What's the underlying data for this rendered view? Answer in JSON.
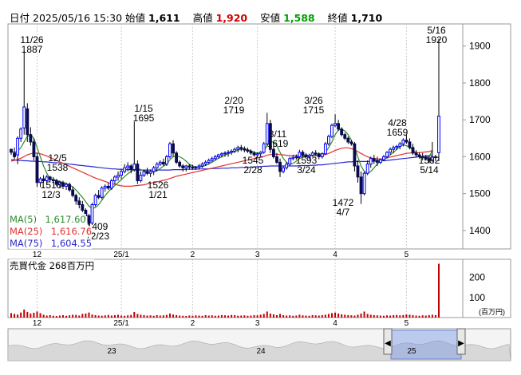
{
  "header": {
    "date_label": "日付",
    "datetime": "2025/05/16 15:30",
    "open_label": "始値",
    "open": "1,611",
    "high_label": "高値",
    "high": "1,920",
    "low_label": "安値",
    "low": "1,588",
    "close_label": "終値",
    "close": "1,710"
  },
  "moving_averages": [
    {
      "label": "MA(5)",
      "value": "1,617.60",
      "color": "#2e8b2e"
    },
    {
      "label": "MA(25)",
      "value": "1,616.76",
      "color": "#e03030"
    },
    {
      "label": "MA(75)",
      "value": "1,604.55",
      "color": "#2828d0"
    }
  ],
  "volume_panel": {
    "label": "売買代金",
    "value": "268百万円",
    "unit": "(百万円)"
  },
  "colors": {
    "up": "#0000ff",
    "down": "#0a0a50",
    "high_value": "#d00000",
    "low_value": "#00a000",
    "volume": "#c00000"
  },
  "chart_data": {
    "type": "candlestick",
    "ylim": [
      1350,
      1960
    ],
    "yticks": [
      1400,
      1500,
      1600,
      1700,
      1800,
      1900
    ],
    "volume_ticks": [
      100,
      200
    ],
    "x_labels": [
      "12",
      "25/1",
      "2",
      "3",
      "4",
      "5"
    ],
    "scroller_labels": [
      "23",
      "24",
      "25"
    ],
    "annotations": [
      {
        "date": "11/26",
        "value": "1887"
      },
      {
        "date": "12/3",
        "value": "1518"
      },
      {
        "date": "12/5",
        "value": "1538"
      },
      {
        "date": "12/23",
        "value": "1409"
      },
      {
        "date": "1/15",
        "value": "1695"
      },
      {
        "date": "1/21",
        "value": "1526"
      },
      {
        "date": "2/20",
        "value": "1719"
      },
      {
        "date": "2/28",
        "value": "1545"
      },
      {
        "date": "3/11",
        "value": "1619"
      },
      {
        "date": "3/24",
        "value": "1593"
      },
      {
        "date": "3/26",
        "value": "1715"
      },
      {
        "date": "4/7",
        "value": "1472"
      },
      {
        "date": "4/28",
        "value": "1659"
      },
      {
        "date": "5/14",
        "value": "1582"
      },
      {
        "date": "5/16",
        "value": "1920"
      }
    ],
    "candles": [
      [
        1620,
        1622,
        1605,
        1612
      ],
      [
        1610,
        1625,
        1592,
        1600
      ],
      [
        1605,
        1655,
        1580,
        1650
      ],
      [
        1650,
        1680,
        1640,
        1675
      ],
      [
        1678,
        1887,
        1660,
        1735
      ],
      [
        1730,
        1745,
        1640,
        1660
      ],
      [
        1660,
        1680,
        1630,
        1640
      ],
      [
        1640,
        1650,
        1590,
        1600
      ],
      [
        1600,
        1610,
        1518,
        1530
      ],
      [
        1530,
        1545,
        1518,
        1540
      ],
      [
        1540,
        1550,
        1530,
        1535
      ],
      [
        1535,
        1550,
        1525,
        1545
      ],
      [
        1545,
        1548,
        1530,
        1538
      ],
      [
        1538,
        1545,
        1530,
        1535
      ],
      [
        1535,
        1540,
        1520,
        1525
      ],
      [
        1525,
        1535,
        1515,
        1530
      ],
      [
        1530,
        1535,
        1512,
        1520
      ],
      [
        1520,
        1530,
        1510,
        1525
      ],
      [
        1525,
        1530,
        1505,
        1510
      ],
      [
        1510,
        1520,
        1490,
        1495
      ],
      [
        1495,
        1500,
        1470,
        1480
      ],
      [
        1480,
        1490,
        1460,
        1470
      ],
      [
        1470,
        1480,
        1450,
        1455
      ],
      [
        1455,
        1460,
        1430,
        1440
      ],
      [
        1440,
        1445,
        1409,
        1420
      ],
      [
        1420,
        1475,
        1415,
        1470
      ],
      [
        1470,
        1500,
        1465,
        1495
      ],
      [
        1495,
        1510,
        1485,
        1490
      ],
      [
        1490,
        1520,
        1485,
        1515
      ],
      [
        1515,
        1525,
        1505,
        1520
      ],
      [
        1520,
        1530,
        1510,
        1515
      ],
      [
        1515,
        1540,
        1510,
        1535
      ],
      [
        1535,
        1550,
        1525,
        1545
      ],
      [
        1545,
        1560,
        1535,
        1550
      ],
      [
        1550,
        1565,
        1540,
        1560
      ],
      [
        1560,
        1580,
        1555,
        1570
      ],
      [
        1570,
        1585,
        1560,
        1575
      ],
      [
        1575,
        1580,
        1555,
        1565
      ],
      [
        1565,
        1695,
        1560,
        1580
      ],
      [
        1580,
        1590,
        1526,
        1535
      ],
      [
        1535,
        1560,
        1530,
        1550
      ],
      [
        1550,
        1565,
        1545,
        1560
      ],
      [
        1560,
        1570,
        1550,
        1555
      ],
      [
        1555,
        1565,
        1545,
        1560
      ],
      [
        1560,
        1575,
        1550,
        1570
      ],
      [
        1570,
        1585,
        1560,
        1580
      ],
      [
        1580,
        1590,
        1575,
        1585
      ],
      [
        1585,
        1595,
        1575,
        1580
      ],
      [
        1580,
        1605,
        1575,
        1600
      ],
      [
        1600,
        1640,
        1595,
        1635
      ],
      [
        1635,
        1645,
        1600,
        1610
      ],
      [
        1610,
        1615,
        1580,
        1585
      ],
      [
        1585,
        1590,
        1570,
        1575
      ],
      [
        1575,
        1580,
        1560,
        1570
      ],
      [
        1570,
        1578,
        1560,
        1575
      ],
      [
        1575,
        1580,
        1565,
        1572
      ],
      [
        1572,
        1578,
        1565,
        1570
      ],
      [
        1570,
        1575,
        1565,
        1572
      ],
      [
        1572,
        1580,
        1565,
        1575
      ],
      [
        1575,
        1585,
        1570,
        1580
      ],
      [
        1580,
        1590,
        1575,
        1585
      ],
      [
        1585,
        1595,
        1580,
        1590
      ],
      [
        1590,
        1600,
        1585,
        1595
      ],
      [
        1595,
        1605,
        1590,
        1600
      ],
      [
        1600,
        1608,
        1595,
        1605
      ],
      [
        1605,
        1612,
        1598,
        1608
      ],
      [
        1608,
        1615,
        1600,
        1610
      ],
      [
        1610,
        1618,
        1600,
        1612
      ],
      [
        1612,
        1620,
        1605,
        1615
      ],
      [
        1615,
        1625,
        1610,
        1620
      ],
      [
        1620,
        1630,
        1612,
        1625
      ],
      [
        1625,
        1632,
        1615,
        1622
      ],
      [
        1622,
        1628,
        1612,
        1618
      ],
      [
        1618,
        1625,
        1610,
        1615
      ],
      [
        1615,
        1620,
        1605,
        1610
      ],
      [
        1610,
        1615,
        1600,
        1605
      ],
      [
        1605,
        1612,
        1598,
        1608
      ],
      [
        1608,
        1615,
        1600,
        1612
      ],
      [
        1612,
        1640,
        1608,
        1635
      ],
      [
        1635,
        1719,
        1630,
        1690
      ],
      [
        1690,
        1700,
        1610,
        1620
      ],
      [
        1620,
        1630,
        1595,
        1600
      ],
      [
        1600,
        1610,
        1580,
        1585
      ],
      [
        1585,
        1595,
        1545,
        1560
      ],
      [
        1560,
        1575,
        1555,
        1570
      ],
      [
        1570,
        1585,
        1565,
        1580
      ],
      [
        1580,
        1600,
        1575,
        1595
      ],
      [
        1595,
        1605,
        1590,
        1598
      ],
      [
        1598,
        1606,
        1592,
        1600
      ],
      [
        1600,
        1619,
        1595,
        1612
      ],
      [
        1612,
        1618,
        1600,
        1605
      ],
      [
        1605,
        1610,
        1595,
        1600
      ],
      [
        1600,
        1608,
        1592,
        1604
      ],
      [
        1604,
        1615,
        1600,
        1610
      ],
      [
        1610,
        1618,
        1602,
        1608
      ],
      [
        1608,
        1612,
        1593,
        1600
      ],
      [
        1600,
        1612,
        1595,
        1608
      ],
      [
        1608,
        1640,
        1605,
        1635
      ],
      [
        1635,
        1660,
        1630,
        1655
      ],
      [
        1655,
        1690,
        1650,
        1685
      ],
      [
        1685,
        1715,
        1680,
        1690
      ],
      [
        1690,
        1700,
        1670,
        1675
      ],
      [
        1675,
        1680,
        1655,
        1660
      ],
      [
        1660,
        1665,
        1645,
        1650
      ],
      [
        1650,
        1655,
        1635,
        1640
      ],
      [
        1640,
        1645,
        1630,
        1635
      ],
      [
        1635,
        1640,
        1560,
        1575
      ],
      [
        1575,
        1590,
        1530,
        1545
      ],
      [
        1545,
        1560,
        1472,
        1500
      ],
      [
        1500,
        1560,
        1495,
        1555
      ],
      [
        1555,
        1590,
        1550,
        1580
      ],
      [
        1580,
        1600,
        1570,
        1595
      ],
      [
        1595,
        1605,
        1580,
        1590
      ],
      [
        1590,
        1600,
        1575,
        1585
      ],
      [
        1585,
        1595,
        1580,
        1592
      ],
      [
        1592,
        1605,
        1588,
        1600
      ],
      [
        1600,
        1615,
        1595,
        1612
      ],
      [
        1612,
        1625,
        1605,
        1620
      ],
      [
        1620,
        1630,
        1610,
        1625
      ],
      [
        1625,
        1632,
        1618,
        1628
      ],
      [
        1628,
        1640,
        1620,
        1635
      ],
      [
        1635,
        1650,
        1628,
        1645
      ],
      [
        1645,
        1659,
        1635,
        1640
      ],
      [
        1640,
        1650,
        1620,
        1625
      ],
      [
        1625,
        1635,
        1605,
        1610
      ],
      [
        1610,
        1618,
        1598,
        1605
      ],
      [
        1605,
        1612,
        1595,
        1600
      ],
      [
        1600,
        1610,
        1590,
        1598
      ],
      [
        1598,
        1605,
        1590,
        1595
      ],
      [
        1595,
        1602,
        1582,
        1590
      ],
      [
        1590,
        1640,
        1585,
        1600
      ],
      [
        1600,
        1605,
        1588,
        1598
      ],
      [
        1611,
        1920,
        1588,
        1710
      ]
    ],
    "ma5": [
      1615,
      1612,
      1615,
      1625,
      1640,
      1655,
      1660,
      1650,
      1625,
      1600,
      1575,
      1555,
      1540,
      1538,
      1536,
      1533,
      1530,
      1527,
      1524,
      1518,
      1510,
      1500,
      1490,
      1478,
      1466,
      1460,
      1462,
      1470,
      1482,
      1495,
      1505,
      1514,
      1522,
      1530,
      1538,
      1546,
      1554,
      1560,
      1565,
      1568,
      1565,
      1562,
      1560,
      1558,
      1559,
      1562,
      1568,
      1574,
      1580,
      1592,
      1600,
      1602,
      1600,
      1595,
      1588,
      1580,
      1575,
      1572,
      1572,
      1573,
      1576,
      1580,
      1585,
      1590,
      1596,
      1600,
      1604,
      1608,
      1611,
      1614,
      1618,
      1620,
      1620,
      1619,
      1616,
      1612,
      1610,
      1610,
      1617,
      1630,
      1640,
      1640,
      1630,
      1612,
      1595,
      1585,
      1580,
      1582,
      1588,
      1595,
      1600,
      1602,
      1604,
      1605,
      1606,
      1604,
      1605,
      1612,
      1625,
      1640,
      1660,
      1672,
      1675,
      1670,
      1660,
      1645,
      1625,
      1600,
      1575,
      1560,
      1555,
      1560,
      1570,
      1580,
      1588,
      1592,
      1598,
      1605,
      1612,
      1620,
      1628,
      1632,
      1630,
      1625,
      1618,
      1610,
      1602,
      1598,
      1596,
      1598,
      1618
    ],
    "ma25": [
      1588,
      1590,
      1593,
      1596,
      1600,
      1605,
      1608,
      1610,
      1610,
      1608,
      1605,
      1602,
      1598,
      1594,
      1590,
      1586,
      1582,
      1578,
      1574,
      1570,
      1566,
      1562,
      1558,
      1554,
      1550,
      1546,
      1542,
      1539,
      1536,
      1533,
      1530,
      1527,
      1525,
      1523,
      1521,
      1520,
      1520,
      1520,
      1521,
      1522,
      1523,
      1524,
      1526,
      1528,
      1530,
      1532,
      1534,
      1536,
      1538,
      1541,
      1544,
      1547,
      1549,
      1551,
      1553,
      1555,
      1557,
      1559,
      1561,
      1563,
      1565,
      1567,
      1569,
      1571,
      1573,
      1575,
      1577,
      1579,
      1581,
      1583,
      1585,
      1587,
      1589,
      1591,
      1593,
      1595,
      1597,
      1599,
      1601,
      1604,
      1606,
      1607,
      1607,
      1606,
      1605,
      1604,
      1603,
      1603,
      1603,
      1603,
      1603,
      1603,
      1603,
      1603,
      1603,
      1603,
      1604,
      1606,
      1609,
      1613,
      1617,
      1620,
      1623,
      1624,
      1624,
      1622,
      1619,
      1614,
      1609,
      1604,
      1600,
      1597,
      1595,
      1594,
      1594,
      1595,
      1597,
      1599,
      1601,
      1603,
      1605,
      1607,
      1609,
      1610,
      1611,
      1611,
      1611,
      1612,
      1613,
      1614,
      1617
    ],
    "ma75": [
      1592,
      1591,
      1590,
      1590,
      1589,
      1589,
      1588,
      1588,
      1587,
      1587,
      1586,
      1586,
      1585,
      1584,
      1584,
      1583,
      1582,
      1581,
      1580,
      1579,
      1578,
      1577,
      1576,
      1575,
      1574,
      1573,
      1572,
      1571,
      1570,
      1569,
      1568,
      1567,
      1567,
      1566,
      1566,
      1565,
      1565,
      1565,
      1564,
      1564,
      1564,
      1564,
      1564,
      1564,
      1564,
      1564,
      1564,
      1564,
      1564,
      1564,
      1565,
      1565,
      1565,
      1565,
      1566,
      1566,
      1566,
      1566,
      1567,
      1567,
      1567,
      1567,
      1568,
      1568,
      1568,
      1569,
      1569,
      1569,
      1570,
      1570,
      1570,
      1571,
      1571,
      1571,
      1572,
      1572,
      1573,
      1573,
      1574,
      1574,
      1575,
      1575,
      1575,
      1575,
      1575,
      1575,
      1575,
      1575,
      1575,
      1576,
      1576,
      1576,
      1576,
      1577,
      1577,
      1578,
      1578,
      1579,
      1580,
      1581,
      1582,
      1583,
      1584,
      1585,
      1586,
      1586,
      1587,
      1587,
      1587,
      1587,
      1587,
      1587,
      1588,
      1588,
      1589,
      1589,
      1590,
      1591,
      1592,
      1593,
      1594,
      1595,
      1596,
      1597,
      1598,
      1599,
      1600,
      1601,
      1602,
      1603,
      1605
    ],
    "volume": [
      22,
      18,
      15,
      25,
      40,
      28,
      20,
      24,
      30,
      22,
      14,
      10,
      12,
      9,
      8,
      10,
      12,
      9,
      11,
      14,
      13,
      10,
      18,
      20,
      25,
      15,
      12,
      10,
      9,
      11,
      13,
      10,
      12,
      14,
      10,
      9,
      11,
      13,
      28,
      18,
      14,
      12,
      10,
      11,
      9,
      12,
      10,
      11,
      13,
      20,
      15,
      12,
      10,
      9,
      8,
      10,
      9,
      11,
      10,
      9,
      12,
      10,
      11,
      9,
      10,
      12,
      11,
      10,
      13,
      12,
      9,
      10,
      11,
      9,
      10,
      12,
      11,
      14,
      18,
      30,
      20,
      16,
      12,
      18,
      12,
      10,
      11,
      9,
      10,
      14,
      11,
      10,
      9,
      12,
      11,
      10,
      12,
      14,
      18,
      22,
      25,
      20,
      16,
      14,
      12,
      11,
      10,
      14,
      20,
      30,
      18,
      14,
      12,
      11,
      10,
      9,
      11,
      10,
      12,
      13,
      11,
      12,
      15,
      14,
      12,
      10,
      9,
      11,
      10,
      12,
      14,
      12,
      268
    ]
  }
}
